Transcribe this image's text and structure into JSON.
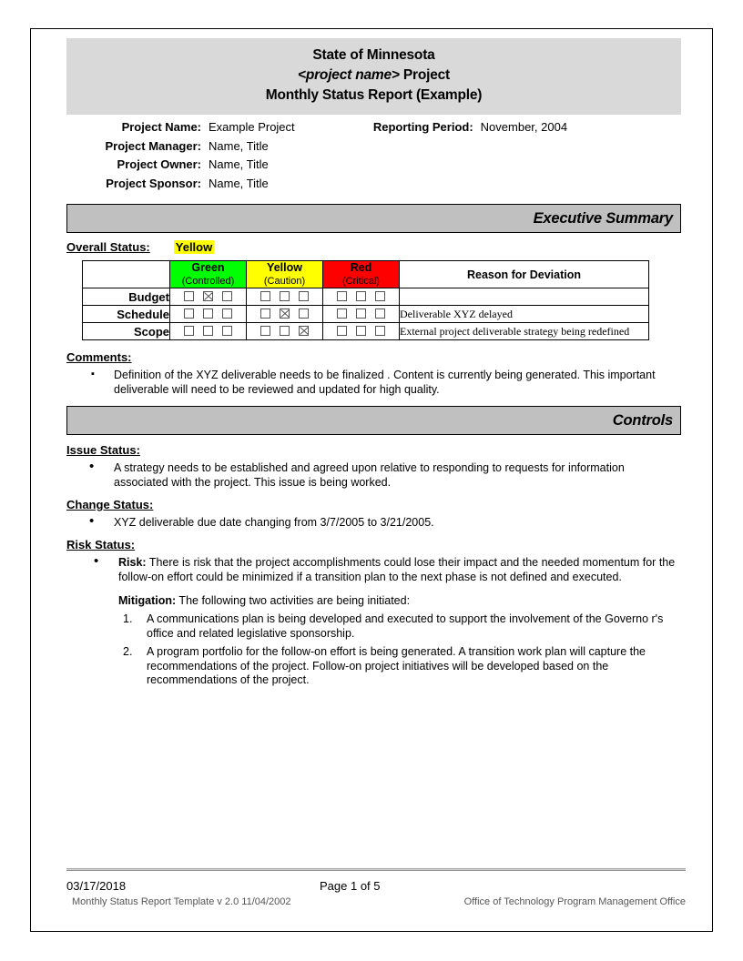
{
  "header": {
    "line1": "State of Minnesota",
    "line2_italic": "<project name>",
    "line2_rest": " Project",
    "line3": "Monthly Status Report (Example)"
  },
  "project_info": {
    "rows_left": [
      {
        "label": "Project Name:",
        "value": "Example Project"
      },
      {
        "label": "Project Manager:",
        "value": "Name, Title"
      },
      {
        "label": "Project Owner:",
        "value": "Name, Title"
      },
      {
        "label": "Project Sponsor:",
        "value": "Name, Title"
      }
    ],
    "rows_right": [
      {
        "label": "Reporting Period:",
        "value": "November, 2004"
      }
    ]
  },
  "sections": {
    "executive_summary": "Executive Summary",
    "controls": "Controls"
  },
  "overall_status": {
    "label": "Overall Status:",
    "value": "Yellow",
    "highlight_color": "#FFFF00"
  },
  "status_table": {
    "colors": {
      "green": "#00FF00",
      "yellow": "#FFFF00",
      "red": "#FF0000"
    },
    "headers": [
      {
        "name": "",
        "sub": ""
      },
      {
        "name": "Green",
        "sub": "(Controlled)"
      },
      {
        "name": "Yellow",
        "sub": "(Caution)"
      },
      {
        "name": "Red",
        "sub": "(Critical)"
      },
      {
        "name": "Reason for Deviation",
        "sub": ""
      }
    ],
    "rows": [
      {
        "label": "Budget",
        "green": [
          false,
          true,
          false
        ],
        "yellow": [
          false,
          false,
          false
        ],
        "red": [
          false,
          false,
          false
        ],
        "reason": ""
      },
      {
        "label": "Schedule",
        "green": [
          false,
          false,
          false
        ],
        "yellow": [
          false,
          true,
          false
        ],
        "red": [
          false,
          false,
          false
        ],
        "reason": "Deliverable XYZ delayed"
      },
      {
        "label": "Scope",
        "green": [
          false,
          false,
          false
        ],
        "yellow": [
          false,
          false,
          true
        ],
        "red": [
          false,
          false,
          false
        ],
        "reason": "External project deliverable strategy being redefined"
      }
    ]
  },
  "comments": {
    "heading": "Comments:",
    "items": [
      "Definition of the  XYZ  deliverable  needs to be finalized .  Content is currently being generated.  This important deliverable will need to be reviewed and updated for high quality."
    ]
  },
  "issue_status": {
    "heading": "Issue Status:",
    "items": [
      "A strategy needs to be established  and agreed upon relative to   responding to  requests for information associated with the project.  This issue is being worked."
    ]
  },
  "change_status": {
    "heading": "Change Status:",
    "items": [
      "XYZ  deliverable due date changing from   3/7/2005 to 3/21/2005."
    ]
  },
  "risk_status": {
    "heading": "Risk Status:",
    "risk_label": "Risk:",
    "risk_text": " There is risk that the  project  accomplishments  could lose their impact and the needed momentum for the follow-on effort could be   minimized if a transition  plan to the  next phase is not defined and executed.",
    "mitigation_label": "Mitigation:",
    "mitigation_text": "  The following two activities are being initiated:",
    "mitigation_items": [
      "A communications plan is being developed and executed to support the involvement of the Governo r's office and related legislative sponsorship.",
      "A program portfolio for the follow-on effort is being generated. A transition work plan will capture the recommendations of the project. Follow-on project initiatives will be developed based on the recommendations of the project."
    ]
  },
  "footer": {
    "date": "03/17/2018",
    "page": "Page 1 of 5",
    "template": "Monthly Status Report Template  v 2.0  11/04/2002",
    "office": "Office of Technology Program Management Office"
  }
}
